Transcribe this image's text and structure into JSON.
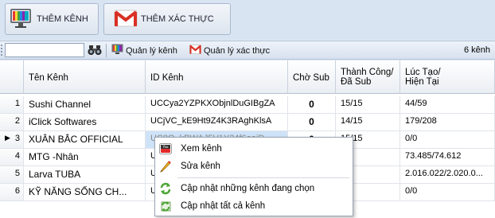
{
  "ribbon": {
    "add_channel_label": "THÊM KÊNH",
    "add_auth_label": "THÊM XÁC THỰC"
  },
  "toolbar": {
    "search_value": "",
    "channel_mgmt_label": "Quản lý kênh",
    "auth_mgmt_label": "Quản lý xác thực",
    "count_label": "6 kênh"
  },
  "grid": {
    "columns": {
      "name": "Tên Kênh",
      "id": "ID Kênh",
      "pending": "Chờ Sub",
      "success": "Thành Công/\nĐã Sub",
      "time": "Lúc Tạo/\nHiện Tại"
    },
    "rows": [
      {
        "num": "1",
        "name": "Sushi Channel",
        "id": "UCCya2YZPKXObjnlDuGIBgZA",
        "pending": "0",
        "success": "15/15",
        "time": "44/59"
      },
      {
        "num": "2",
        "name": "iClick Softwares",
        "id": "UCjVC_kE9Ht9Z4K3RAghKlsA",
        "pending": "0",
        "success": "14/15",
        "time": "179/208"
      },
      {
        "num": "3",
        "name": "XUÂN BẮC OFFICIAL",
        "id": "UC8O_kBWAJ5V1Y24f6aaiD",
        "pending": "0",
        "success": "15/15",
        "time": "0/0"
      },
      {
        "num": "4",
        "name": "MTG -Nhân",
        "id": "U",
        "pending": "",
        "success": "5",
        "time": "73.485/74.612"
      },
      {
        "num": "5",
        "name": "Larva TUBA",
        "id": "U",
        "pending": "",
        "success": "5",
        "time": "2.016.022/2.020.0..."
      },
      {
        "num": "6",
        "name": "KỸ NĂNG SỐNG CH...",
        "id": "U",
        "pending": "",
        "success": "",
        "time": "0/0"
      }
    ]
  },
  "context_menu": {
    "view_channel": "Xem kênh",
    "edit_channel": "Sửa kênh",
    "update_selected": "Cập nhật những kênh đang chọn",
    "update_all": "Cập nhật tất cả kênh"
  },
  "colors": {
    "selection": "#cfe3f8",
    "menu_border": "#9aa5b4",
    "youtube_red": "#e32b2b",
    "refresh_green": "#4aa531"
  }
}
